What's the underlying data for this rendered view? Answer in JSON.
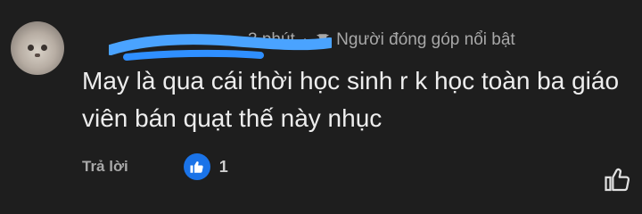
{
  "comment": {
    "author_redacted": true,
    "time": "3 phút",
    "separator": "·",
    "badge": "Người đóng góp nổi bật",
    "text": "May là qua cái thời học sinh r k học toàn ba giáo viên bán quạt thế này nhục",
    "reply_label": "Trả lời",
    "like_count": "1"
  },
  "colors": {
    "background": "#1e1e1e",
    "like_blue": "#1a73e8",
    "redaction": "#3b97ff"
  },
  "icons": {
    "badge": "award-icon",
    "like": "thumbs-up-icon",
    "dislike_or_like_outline": "thumbs-up-outline-icon"
  }
}
